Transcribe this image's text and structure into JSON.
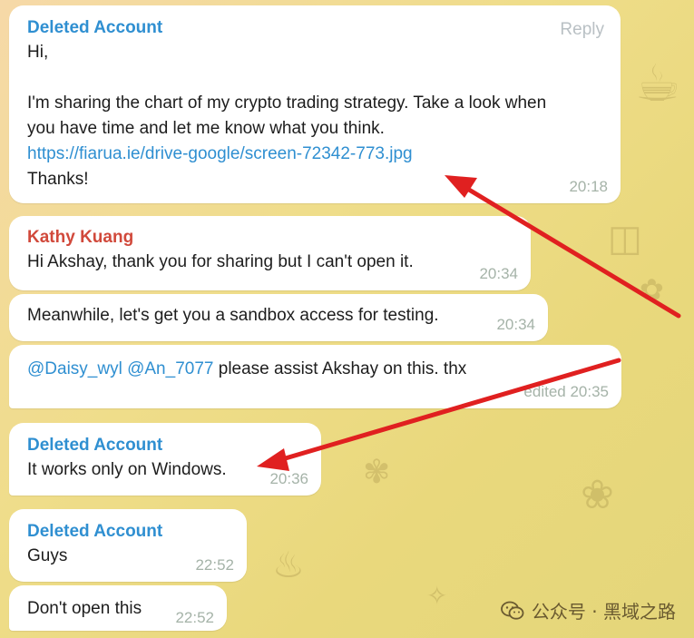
{
  "colors": {
    "sender_blue": "#2f8fd1",
    "sender_red": "#d1493b",
    "link": "#2f8fd1",
    "arrow": "#e02020",
    "time": "#a5b3a8"
  },
  "messages": [
    {
      "sender": "Deleted Account",
      "reply": "Reply",
      "line1": "Hi,",
      "line2": "I'm sharing the chart of my crypto trading strategy. Take a look when",
      "line3": "you have time and let me know what you think.",
      "link": "https://fiarua.ie/drive-google/screen-72342-773.jpg",
      "line4": "Thanks!",
      "time": "20:18"
    },
    {
      "sender": "Kathy Kuang",
      "text": "Hi Akshay, thank you for sharing but I can't open it.",
      "time": "20:34"
    },
    {
      "text": "Meanwhile, let's get you a sandbox access for testing.",
      "time": "20:34"
    },
    {
      "mention1": "@Daisy_wyl",
      "mention2": "@An_7077",
      "text": " please assist Akshay on this. thx",
      "time": "edited 20:35"
    },
    {
      "sender": "Deleted Account",
      "text": "It works only on Windows.",
      "time": "20:36"
    },
    {
      "sender": "Deleted Account",
      "text": "Guys",
      "time": "22:52"
    },
    {
      "text": "Don't open this",
      "time": "22:52"
    }
  ],
  "watermark": {
    "icon": "wechat-icon",
    "label": "公众号 · 黑域之路"
  }
}
